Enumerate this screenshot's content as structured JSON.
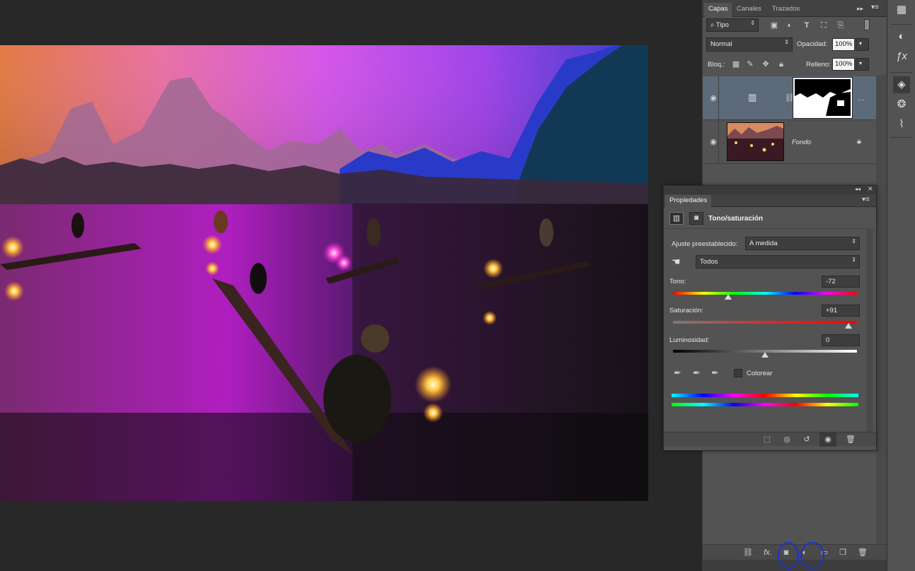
{
  "layers_panel": {
    "tabs": [
      "Capas",
      "Canales",
      "Trazados"
    ],
    "filter_type": "Tipo",
    "blend_mode": "Normal",
    "opacity_label": "Opacidad:",
    "opacity_value": "100%",
    "lock_label": "Bloq.:",
    "fill_label": "Relleno:",
    "fill_value": "100%",
    "layers": [
      {
        "name": "",
        "kind": "adjustment",
        "visible": true,
        "selected": true
      },
      {
        "name": "Fondo",
        "kind": "background",
        "visible": true,
        "locked": true,
        "selected": false
      }
    ]
  },
  "properties": {
    "tab": "Propiedades",
    "title": "Tono/saturación",
    "preset_label": "Ajuste preestablecido:",
    "preset_value": "A medida",
    "channel_value": "Todos",
    "hue_label": "Tono:",
    "hue_value": "-72",
    "saturation_label": "Saturación:",
    "saturation_value": "+91",
    "lightness_label": "Luminosidad:",
    "lightness_value": "0",
    "colorize_label": "Colorear",
    "colorize_checked": false
  },
  "colors": {
    "panel_bg": "#535353",
    "selected_layer": "#5c6a7a",
    "annotation_circle": "#1a2fd6"
  }
}
